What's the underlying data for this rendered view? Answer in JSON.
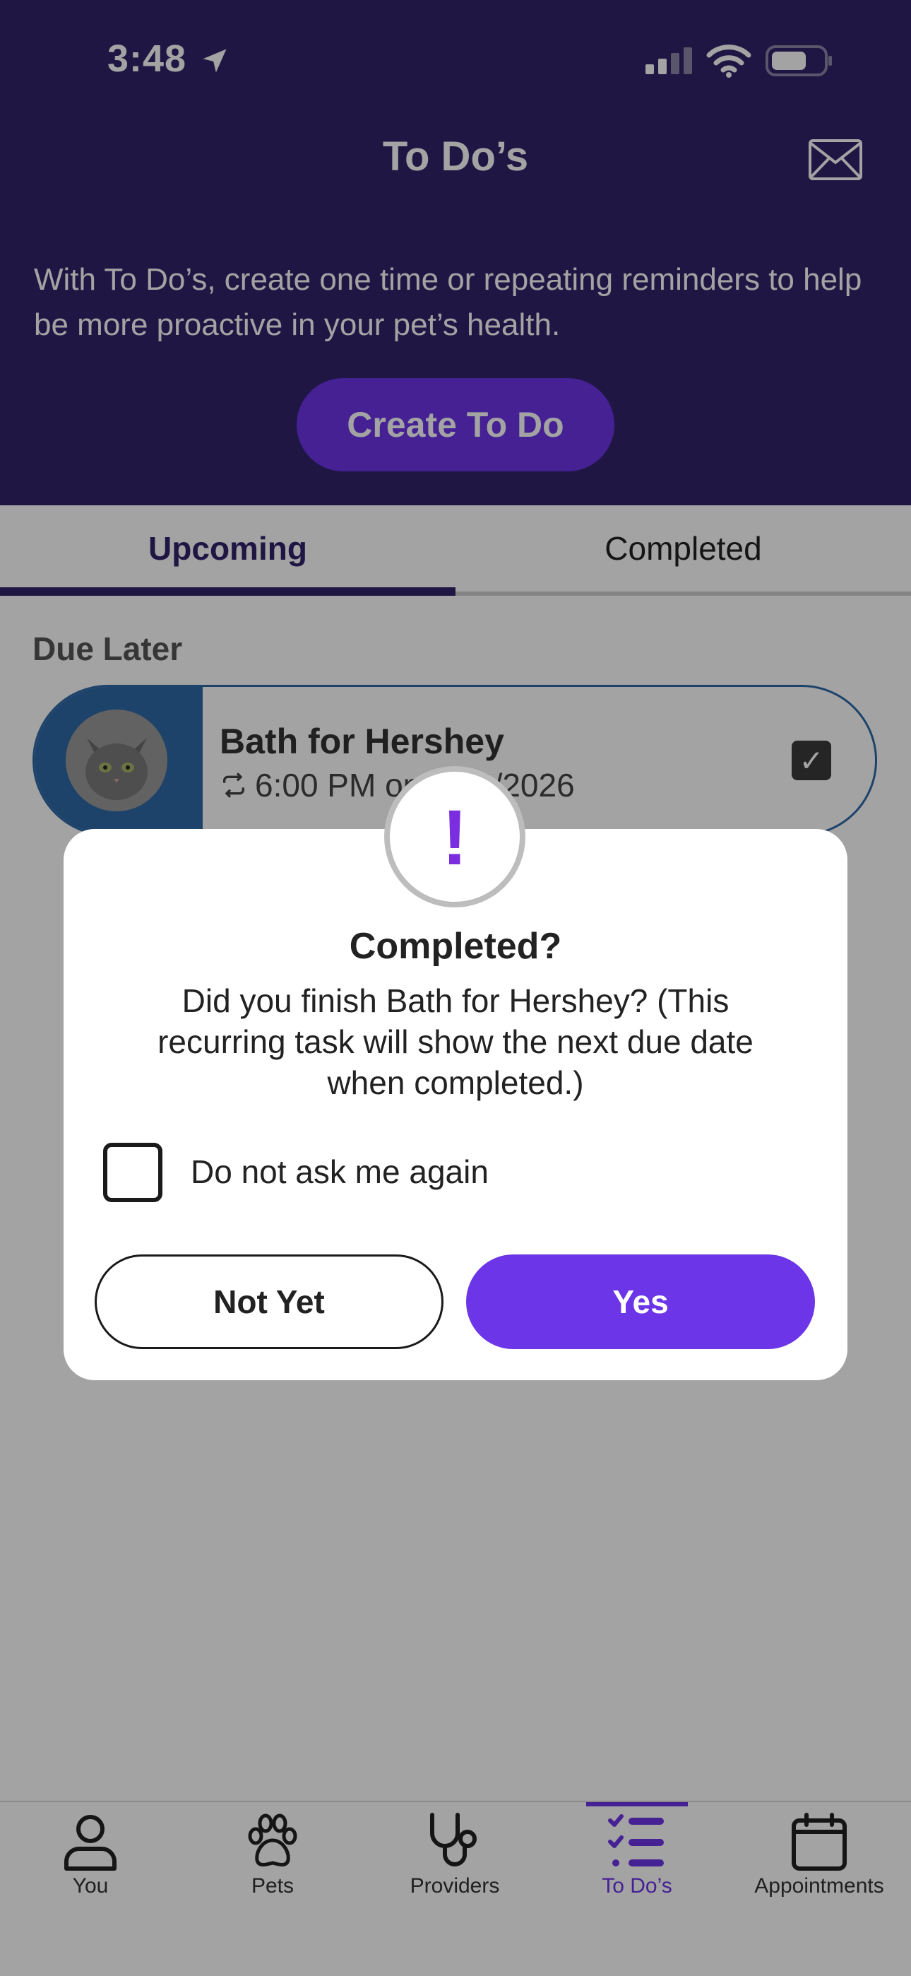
{
  "status_bar": {
    "time": "3:48"
  },
  "header": {
    "title": "To Do’s",
    "intro": "With To Do’s, create one time or repeating reminders to help be more proactive in your pet’s health.",
    "create_button": "Create To Do"
  },
  "tabs": [
    {
      "label": "Upcoming",
      "active": true
    },
    {
      "label": "Completed",
      "active": false
    }
  ],
  "section": {
    "title": "Due Later",
    "items": [
      {
        "title": "Bath for Hershey",
        "schedule": "6:00 PM on 1/26/2026"
      }
    ]
  },
  "dialog": {
    "title": "Completed?",
    "body": "Did you finish Bath for Hershey? (This recurring task will show the next due date when completed.)",
    "checkbox_label": "Do not ask me again",
    "secondary_button": "Not Yet",
    "primary_button": "Yes"
  },
  "bottom_nav": [
    {
      "label": "You",
      "icon": "person-icon"
    },
    {
      "label": "Pets",
      "icon": "paw-icon"
    },
    {
      "label": "Providers",
      "icon": "stethoscope-icon"
    },
    {
      "label": "To Do’s",
      "icon": "checklist-icon",
      "active": true
    },
    {
      "label": "Appointments",
      "icon": "calendar-icon"
    }
  ],
  "colors": {
    "header_bg": "#32236b",
    "accent": "#6c35e8",
    "card_accent": "#2f6aa8"
  }
}
